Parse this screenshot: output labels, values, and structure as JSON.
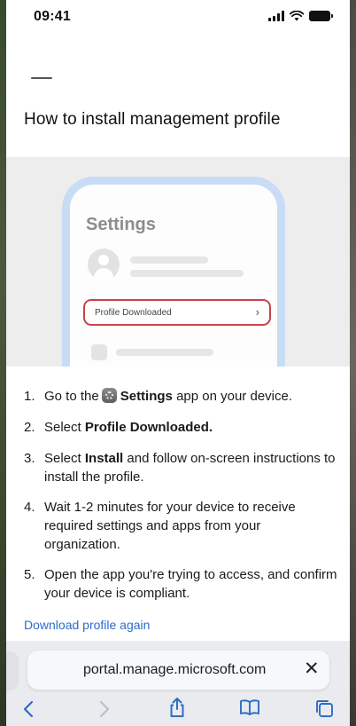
{
  "status_bar": {
    "time": "09:41"
  },
  "page": {
    "title": "How to install management profile"
  },
  "illustration": {
    "title": "Settings",
    "profile_row_label": "Profile Downloaded",
    "chevron": "›"
  },
  "steps": [
    {
      "num": "1.",
      "pre": "Go to the",
      "bold": "Settings",
      "post": "app on your device."
    },
    {
      "num": "2.",
      "pre": "Select",
      "bold": "Profile Downloaded.",
      "post": ""
    },
    {
      "num": "3.",
      "pre": "Select",
      "bold": "Install",
      "post": "and follow on-screen instructions to install the profile."
    },
    {
      "num": "4.",
      "text": "Wait 1-2 minutes for your device to receive required settings and apps from your organization."
    },
    {
      "num": "5.",
      "text": "Open the app you're trying to access, and confirm your device is compliant."
    }
  ],
  "links": {
    "download_again": "Download profile again"
  },
  "browser": {
    "url": "portal.manage.microsoft.com",
    "close_glyph": "✕",
    "toolbar_icons": [
      "back-icon",
      "forward-icon",
      "share-icon",
      "bookmarks-icon",
      "tabs-icon"
    ]
  },
  "colors": {
    "accent": "#2e6dc6",
    "highlight_border": "#c8434b",
    "frame": "#c8dcf5"
  }
}
